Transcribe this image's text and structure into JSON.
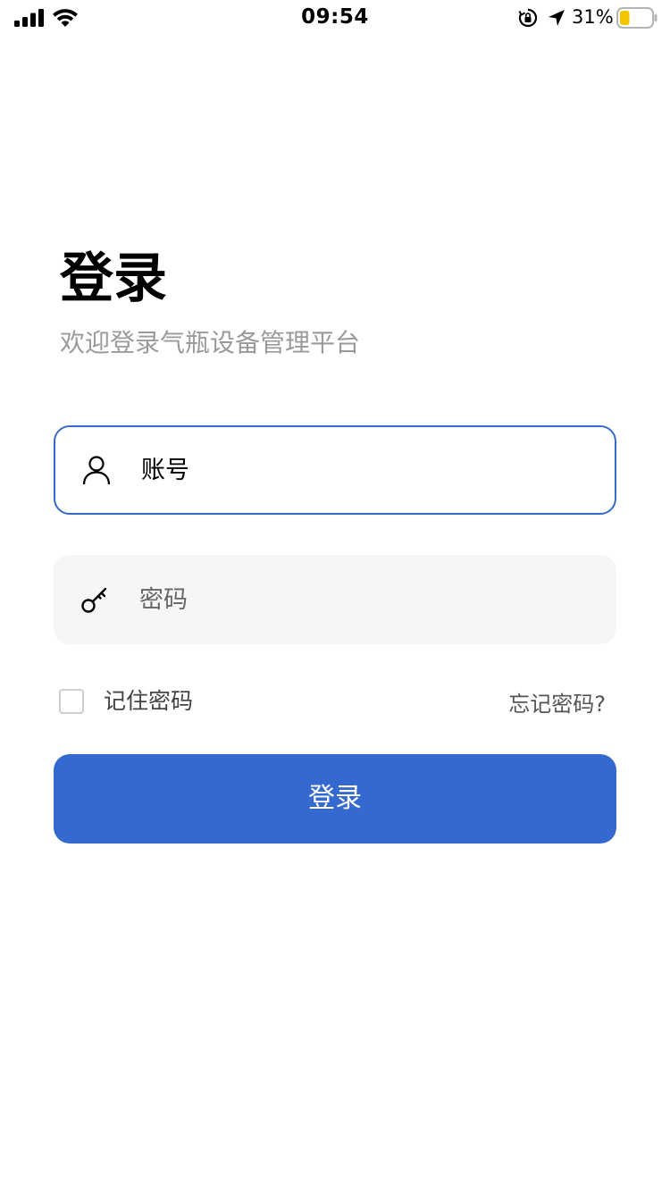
{
  "status_bar": {
    "time": "09:54",
    "battery_percent": "31%",
    "battery_level": 0.31,
    "battery_color": "#f5c400"
  },
  "login": {
    "title": "登录",
    "subtitle": "欢迎登录气瓶设备管理平台",
    "account_placeholder": "账号",
    "password_placeholder": "密码",
    "remember_label": "记住密码",
    "remember_checked": false,
    "forgot_label": "忘记密码?",
    "login_button_label": "登录"
  },
  "colors": {
    "primary": "#3469cf",
    "focused_border": "#3869cf",
    "input_fill": "#f6f6f6",
    "subtitle_text": "#9a9a9a"
  },
  "icons": {
    "account": "user-icon",
    "password": "key-icon"
  }
}
